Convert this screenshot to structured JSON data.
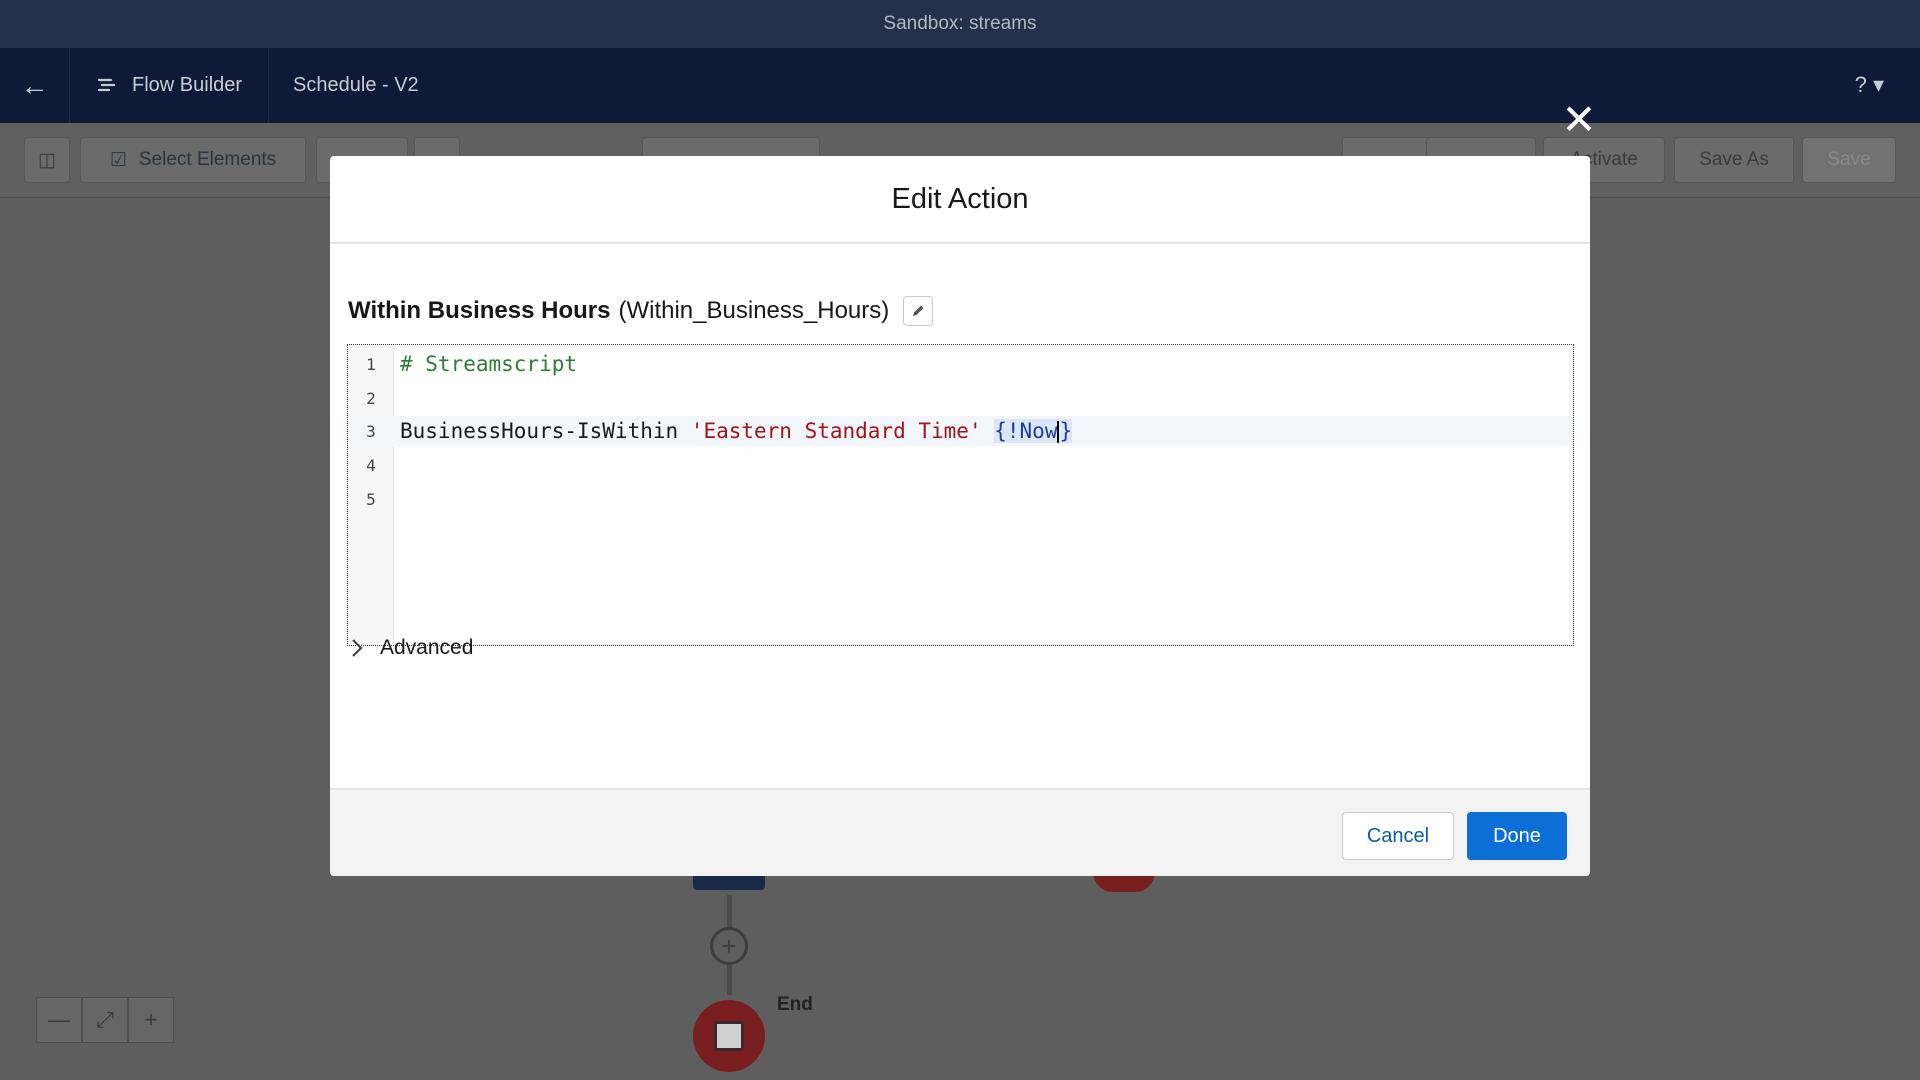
{
  "window": {
    "title": "Sandbox: streams"
  },
  "header": {
    "app_name": "Flow Builder",
    "flow_name": "Schedule - V2",
    "help_label": "?"
  },
  "toolbar": {
    "select_elements_label": "Select Elements",
    "activate_label": "Activate",
    "save_as_label": "Save As",
    "save_label": "Save"
  },
  "canvas": {
    "end_label": "End"
  },
  "modal": {
    "title": "Edit Action",
    "action_label": "Within Business Hours",
    "action_api_name": "(Within_Business_Hours)",
    "editor": {
      "lines": [
        {
          "number": "1",
          "comment": "# Streamscript"
        },
        {
          "number": "2"
        },
        {
          "number": "3",
          "command": "BusinessHours-IsWithin ",
          "string": "'Eastern Standard Time'",
          "var_open": "{!Now",
          "var_close": "}"
        },
        {
          "number": "4"
        },
        {
          "number": "5"
        }
      ]
    },
    "advanced_label": "Advanced",
    "cancel_label": "Cancel",
    "done_label": "Done"
  },
  "colors": {
    "primary_button": "#0b6fd6",
    "header_bg": "#0d1a38",
    "end_node": "#7a1f1f"
  }
}
